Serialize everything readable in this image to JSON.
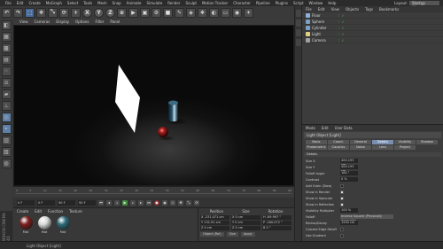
{
  "menu": {
    "items": [
      "File",
      "Edit",
      "Create",
      "MoGraph",
      "Select",
      "Tools",
      "Mesh",
      "Snap",
      "Animate",
      "Simulate",
      "Render",
      "Sculpt",
      "Motion Tracker",
      "Character",
      "Pipeline",
      "Plugins",
      "Script",
      "Window",
      "Help"
    ],
    "layout_label": "Layout:",
    "layout_value": "Startup (User)"
  },
  "toolbar": {
    "axis_x": "X",
    "axis_y": "Y",
    "axis_z": "Z"
  },
  "viewport": {
    "menu": [
      "View",
      "Cameras",
      "Display",
      "Options",
      "Filter",
      "Panel"
    ]
  },
  "timeline": {
    "ticks": [
      "0",
      "5",
      "10",
      "15",
      "20",
      "25",
      "30",
      "35",
      "40",
      "45",
      "50",
      "55",
      "60",
      "65",
      "70",
      "75",
      "80",
      "85",
      "90"
    ],
    "end_frame": "0 F"
  },
  "transport": {
    "start": "0 F",
    "current": "0 F",
    "end": "90 F",
    "end2": "90 F"
  },
  "materials": {
    "menu": [
      "Create",
      "Edit",
      "Function",
      "Texture"
    ],
    "items": [
      {
        "name": "Mat",
        "color": "#7a1f1f"
      },
      {
        "name": "Mat",
        "color": "#d9d9d9"
      },
      {
        "name": "Mat",
        "color": "#2f6a78"
      }
    ]
  },
  "coordinates": {
    "headers": [
      "Position",
      "Size",
      "Rotation"
    ],
    "rows": [
      [
        "X  -231.471 cm",
        "X  0 cm",
        "H  -69.997 °"
      ],
      [
        "Y  131.91 cm",
        "Y  0 cm",
        "P  -160.072 °"
      ],
      [
        "Z  0 cm",
        "Z  0 cm",
        "B  0 °"
      ]
    ],
    "mode": "Object (Rel)",
    "size_mode": "Size",
    "apply": "Apply"
  },
  "status": {
    "text": "Light Object [Light]",
    "brand": "MAXON CINEMA 4D"
  },
  "object_manager": {
    "menu": [
      "File",
      "Edit",
      "View",
      "Objects",
      "Tags",
      "Bookmarks"
    ],
    "objects": [
      {
        "name": "Floor",
        "color": "#8fb0d8"
      },
      {
        "name": "Sphere",
        "color": "#7aa0c8"
      },
      {
        "name": "Cylinder",
        "color": "#7aa0c8"
      },
      {
        "name": "Light",
        "color": "#e0d080"
      },
      {
        "name": "Camera",
        "color": "#a0a0a0"
      }
    ]
  },
  "attribute_manager": {
    "menu": [
      "Mode",
      "Edit",
      "User Data"
    ],
    "title": "Light Object [Light]",
    "tabs": [
      "Basic",
      "Coord.",
      "General",
      "Details",
      "Visibility",
      "Shadow",
      "Photometric",
      "Caustics",
      "Noise",
      "Lens",
      "Project"
    ],
    "active_tab": "Details",
    "section": "Details",
    "props": [
      {
        "label": "Size X",
        "value": "400.193 cm",
        "check": null
      },
      {
        "label": "Size Y",
        "value": "400.193 cm",
        "check": null
      },
      {
        "label": "Falloff Angle",
        "value": "180 °",
        "check": null
      },
      {
        "label": "Contrast",
        "value": "0 %",
        "check": null
      },
      {
        "label": "Add Grain (Slow)",
        "value": "",
        "check": false
      },
      {
        "label": "Show in Render",
        "value": "",
        "check": true
      },
      {
        "label": "Show in Specular",
        "value": "",
        "check": true
      },
      {
        "label": "Show in Reflection",
        "value": "",
        "check": true
      },
      {
        "label": "Visibility Multiplier",
        "value": "100 %",
        "check": null
      },
      {
        "label": "Falloff",
        "value": "Inverse Square (Physically Accurate)",
        "check": null
      },
      {
        "label": "Radius/Decay",
        "value": "1500 cm",
        "check": null
      },
      {
        "label": "Colored Edge Falloff",
        "value": "",
        "check": false
      },
      {
        "label": "Use Gradient",
        "value": "",
        "check": false
      }
    ]
  }
}
